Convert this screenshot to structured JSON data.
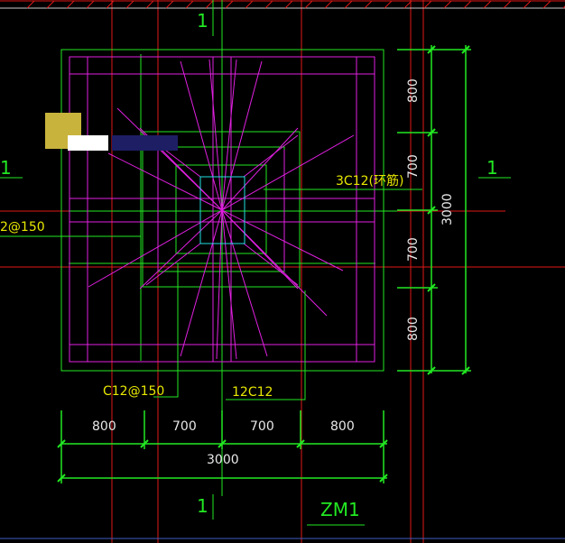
{
  "palette": {
    "background": "#000000",
    "axis_red": "#e01818",
    "frame_green": "#22e822",
    "rebar_magenta": "#e020e0",
    "core_cyan": "#20e0e0",
    "label_yellow": "#e8e800",
    "dimension_text": "#e8e8e8"
  },
  "section_marks": {
    "top": "1",
    "bottom": "1",
    "left": "1",
    "right": "1"
  },
  "annotations": {
    "ring_bar": "3C12(环筋)",
    "left_spacing": "2@150",
    "bottom_spacing": "C12@150",
    "bottom_bars": "12C12"
  },
  "dimensions": {
    "horizontal": [
      "800",
      "700",
      "700",
      "800"
    ],
    "horizontal_total": "3000",
    "vertical": [
      "800",
      "700",
      "700",
      "800"
    ],
    "vertical_total": "3000"
  },
  "title": "ZM1",
  "selection_overlay": {
    "swatch_colors": [
      "#c8b43c",
      "#ffffff",
      "#1e1e64"
    ]
  }
}
